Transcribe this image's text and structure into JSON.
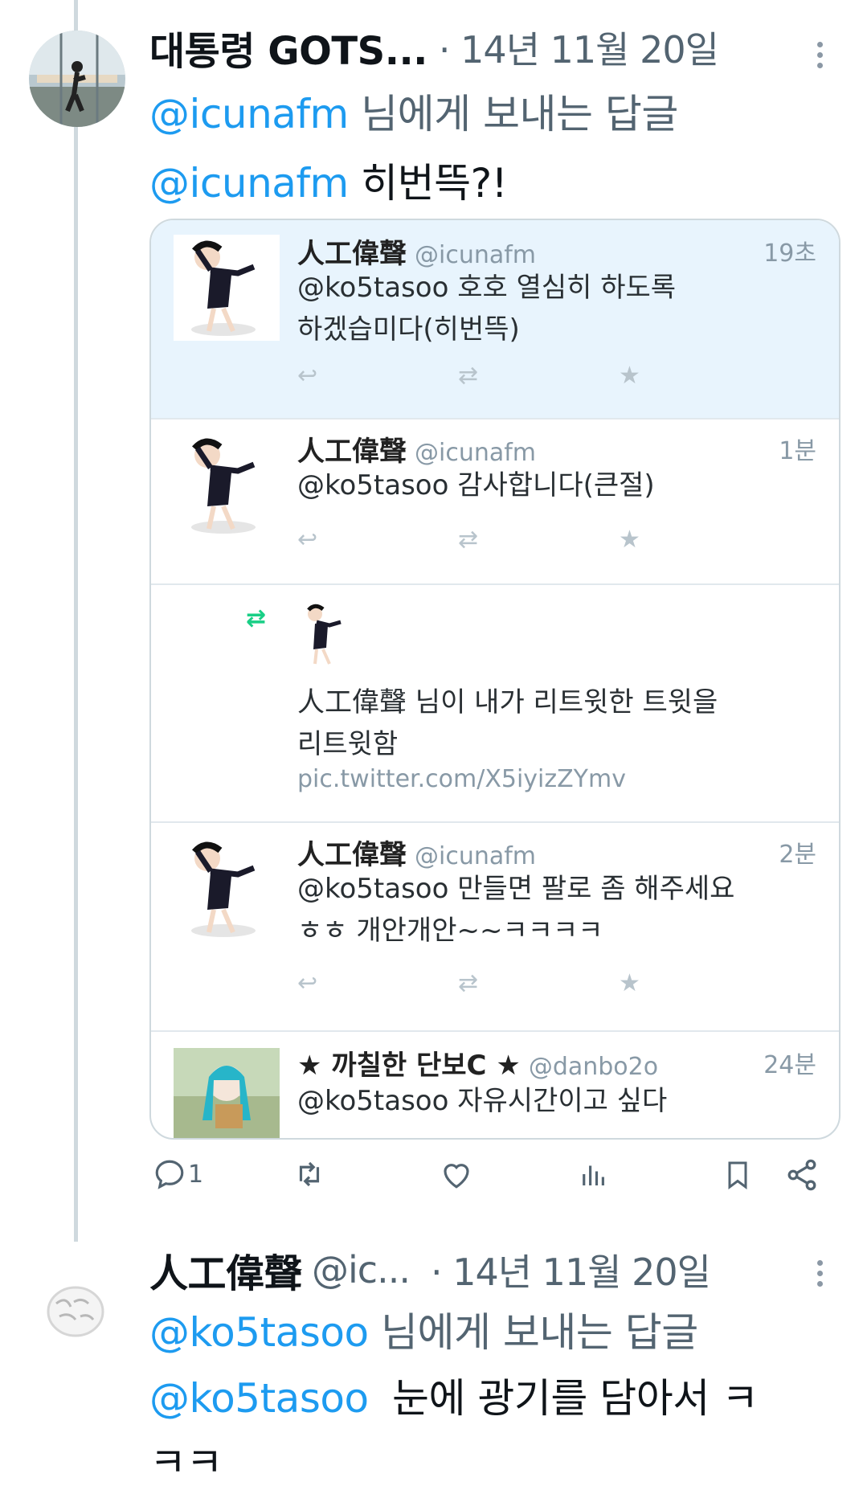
{
  "tweet1": {
    "display_name": "대통령 GOTS...",
    "meta": "· 14년 11월 20일",
    "reply_prefix": "@icunafm",
    "reply_suffix": "님에게 보내는 답글",
    "body_mention": "@icunafm",
    "body_text": "히번뜩?!"
  },
  "embedded": {
    "rows": [
      {
        "name": "人工偉聲",
        "handle": "@icunafm",
        "time": "19초",
        "line1": "@ko5tasoo 호호 열심히 하도록",
        "line2": "하겠습미다(히번뜩)"
      },
      {
        "name": "人工偉聲",
        "handle": "@icunafm",
        "time": "1분",
        "line1": "@ko5tasoo 감사합니다(큰절)"
      },
      {
        "retweet_line1": "人工偉聲 님이 내가 리트윗한 트윗을",
        "retweet_line2": "리트윗함",
        "link": "pic.twitter.com/X5iyizZYmv"
      },
      {
        "name": "人工偉聲",
        "handle": "@icunafm",
        "time": "2분",
        "line1": "@ko5tasoo 만들면 팔로 좀 해주세요",
        "line2": "ㅎㅎ 개안개안~~ㅋㅋㅋㅋ"
      },
      {
        "name": "★ 까칠한 단보C ★",
        "handle": "@danbo2o",
        "time": "24분",
        "line1": "@ko5tasoo 자유시간이고 싶다"
      }
    ]
  },
  "actions": {
    "reply_count": "1",
    "icons": [
      "reply-icon",
      "retweet-icon",
      "like-icon",
      "views-icon",
      "bookmark-icon",
      "share-icon"
    ]
  },
  "tweet2": {
    "display_name": "人工偉聲",
    "handle_trunc": "@ic...",
    "meta": "· 14년 11월 20일",
    "reply_prefix": "@ko5tasoo",
    "reply_suffix": "님에게 보내는 답글",
    "body_mention": "@ko5tasoo",
    "body_line1": "눈에 광기를 담아서 ㅋ",
    "body_line2": "ㅋㅋ"
  },
  "colors": {
    "accent": "#1d9bf0",
    "highlight": "#e8f4fd",
    "retweet_green": "#19cf86"
  }
}
